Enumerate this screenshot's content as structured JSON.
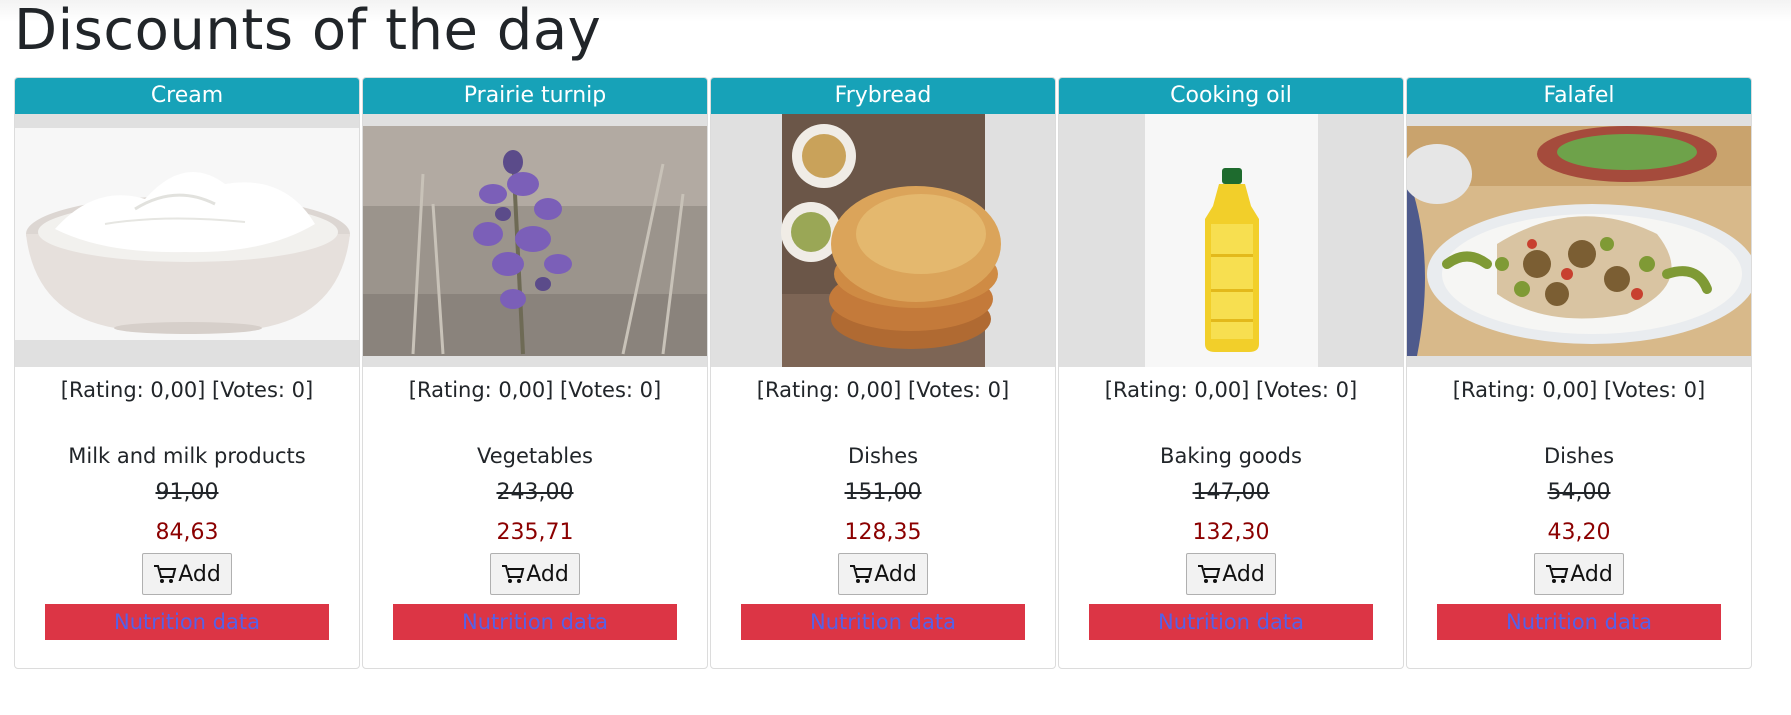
{
  "page": {
    "title": "Discounts of the day"
  },
  "products": [
    {
      "name": "Cream",
      "rating_text": "[Rating: 0,00] [Votes: 0]",
      "category": "Milk and milk products",
      "old_price": "91,00",
      "new_price": "84,63",
      "add_label": "Add",
      "nutrition_label": "Nutrition data"
    },
    {
      "name": "Prairie turnip",
      "rating_text": "[Rating: 0,00] [Votes: 0]",
      "category": "Vegetables",
      "old_price": "243,00",
      "new_price": "235,71",
      "add_label": "Add",
      "nutrition_label": "Nutrition data"
    },
    {
      "name": "Frybread",
      "rating_text": "[Rating: 0,00] [Votes: 0]",
      "category": "Dishes",
      "old_price": "151,00",
      "new_price": "128,35",
      "add_label": "Add",
      "nutrition_label": "Nutrition data"
    },
    {
      "name": "Cooking oil",
      "rating_text": "[Rating: 0,00] [Votes: 0]",
      "category": "Baking goods",
      "old_price": "147,00",
      "new_price": "132,30",
      "add_label": "Add",
      "nutrition_label": "Nutrition data"
    },
    {
      "name": "Falafel",
      "rating_text": "[Rating: 0,00] [Votes: 0]",
      "category": "Dishes",
      "old_price": "54,00",
      "new_price": "43,20",
      "add_label": "Add",
      "nutrition_label": "Nutrition data"
    }
  ],
  "icons": {
    "add_button_icon": "cart-icon"
  },
  "colors": {
    "header_bg": "#17a2b8",
    "discount_price": "#8b0000",
    "nutrition_bg": "#dc3545",
    "nutrition_text": "#5561e8"
  }
}
